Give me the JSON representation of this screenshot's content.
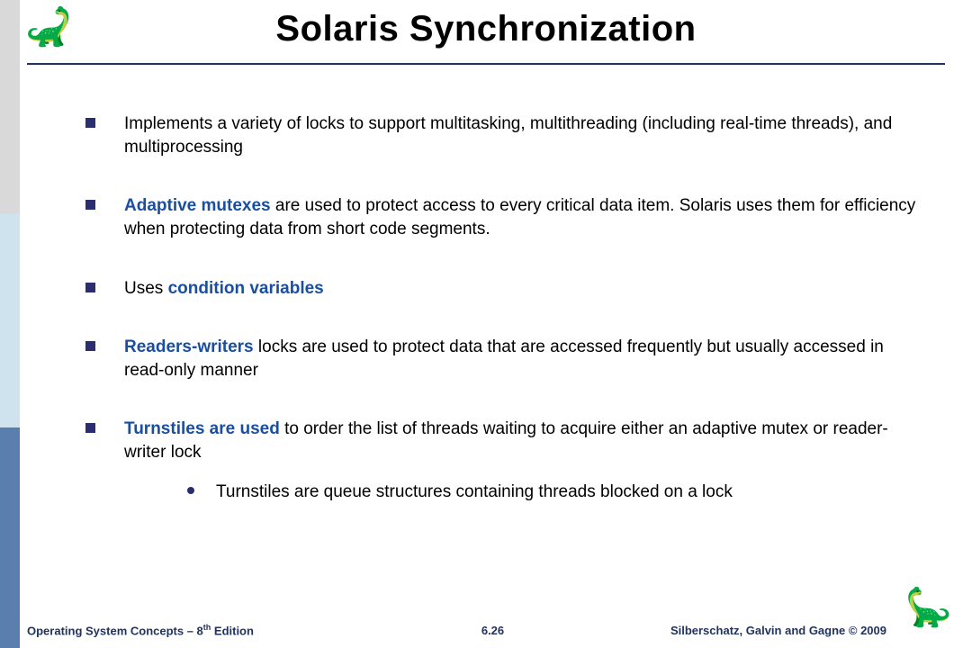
{
  "title": "Solaris Synchronization",
  "bullets": {
    "b1": "Implements a variety of locks to support multitasking, multithreading (including real-time threads), and multiprocessing",
    "b2_hl": "Adaptive mutexes",
    "b2_rest": "  are used  to protect access to every critical data item. Solaris uses them for efficiency when protecting data from short code segments.",
    "b3_pre": "Uses ",
    "b3_hl": "condition variables",
    "b4_hl": "Readers-writers",
    "b4_rest": " locks are used to protect data that are accessed  frequently but usually accessed  in read-only manner",
    "b5_hl": "Turnstiles are used",
    "b5_rest": " to order the list of threads waiting to acquire either an adaptive mutex or reader-writer lock",
    "sub1": "Turnstiles are queue structures containing threads blocked on a lock"
  },
  "footer": {
    "left_a": "Operating System Concepts – 8",
    "left_sup": "th",
    "left_b": " Edition",
    "center": "6.26",
    "right": "Silberschatz, Galvin and Gagne © 2009"
  }
}
